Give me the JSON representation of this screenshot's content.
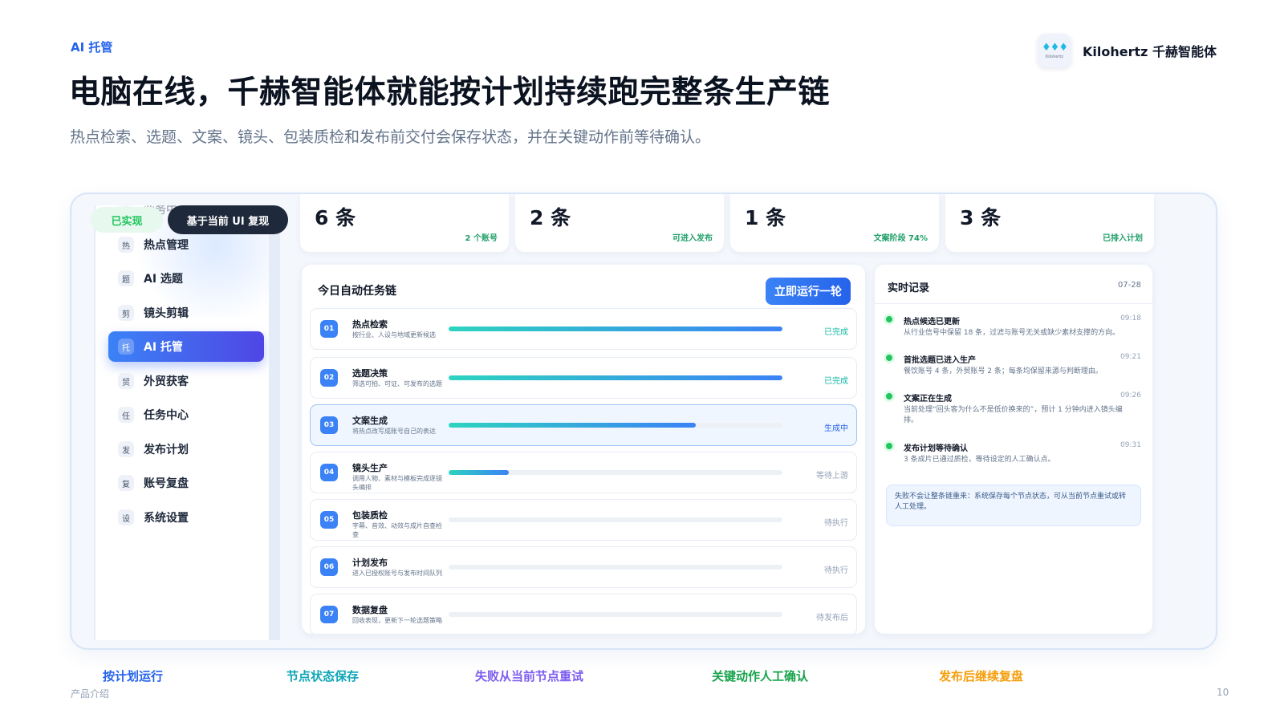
{
  "header": {
    "kicker": "AI 托管",
    "title": "电脑在线，千赫智能体就能按计划持续跑完整条生产链",
    "subtitle": "热点检索、选题、文案、镜头、包装质检和发布前交付会保存状态，并在关键动作前等待确认。",
    "brand_name": "Kilohertz 千赫智能体",
    "brand_logo_text": "Kilohertz"
  },
  "badges": {
    "done": "已实现",
    "replica": "基于当前 UI 复现"
  },
  "sidebar": {
    "items": [
      {
        "icon": "业",
        "label": "业务中心",
        "active": false
      },
      {
        "icon": "热",
        "label": "热点管理",
        "active": false
      },
      {
        "icon": "题",
        "label": "AI 选题",
        "active": false
      },
      {
        "icon": "剪",
        "label": "镜头剪辑",
        "active": false
      },
      {
        "icon": "托",
        "label": "AI 托管",
        "active": true
      },
      {
        "icon": "贸",
        "label": "外贸获客",
        "active": false
      },
      {
        "icon": "任",
        "label": "任务中心",
        "active": false
      },
      {
        "icon": "发",
        "label": "发布计划",
        "active": false
      },
      {
        "icon": "复",
        "label": "账号复盘",
        "active": false
      },
      {
        "icon": "设",
        "label": "系统设置",
        "active": false
      }
    ]
  },
  "stats": [
    {
      "value": "6 条",
      "sub": "2 个账号"
    },
    {
      "value": "2 条",
      "sub": "可进入发布"
    },
    {
      "value": "1 条",
      "sub": "文案阶段 74%"
    },
    {
      "value": "3 条",
      "sub": "已排入计划"
    }
  ],
  "chain": {
    "title": "今日自动任务链",
    "run_button": "立即运行一轮",
    "tasks": [
      {
        "num": "01",
        "name": "热点检索",
        "desc": "按行业、人设与地域更新候选",
        "progress": 1.0,
        "status": "已完成",
        "state": "done"
      },
      {
        "num": "02",
        "name": "选题决策",
        "desc": "筛选可拍、可证、可发布的选题",
        "progress": 1.0,
        "status": "已完成",
        "state": "done"
      },
      {
        "num": "03",
        "name": "文案生成",
        "desc": "将热点改写成账号自己的表达",
        "progress": 0.74,
        "status": "生成中",
        "state": "running"
      },
      {
        "num": "04",
        "name": "镜头生产",
        "desc": "调用人物、素材与模板完成逐镜头编排",
        "progress": 0.18,
        "status": "等待上游",
        "state": "waiting"
      },
      {
        "num": "05",
        "name": "包装质检",
        "desc": "字幕、音效、动效与成片自查检查",
        "progress": 0,
        "status": "待执行",
        "state": "pending"
      },
      {
        "num": "06",
        "name": "计划发布",
        "desc": "进入已授权账号与发布时间队列",
        "progress": 0,
        "status": "待执行",
        "state": "pending"
      },
      {
        "num": "07",
        "name": "数据复盘",
        "desc": "回收表现，更新下一轮选题策略",
        "progress": 0,
        "status": "待发布后",
        "state": "pending"
      }
    ]
  },
  "log": {
    "title": "实时记录",
    "date": "07-28",
    "entries": [
      {
        "title": "热点候选已更新",
        "time": "09:18",
        "desc": "从行业信号中保留 18 条，过滤与账号无关或缺少素材支撑的方向。"
      },
      {
        "title": "首批选题已进入生产",
        "time": "09:21",
        "desc": "餐饮账号 4 条，外贸账号 2 条；每条均保留来源与判断理由。"
      },
      {
        "title": "文案正在生成",
        "time": "09:26",
        "desc": "当前处理“回头客为什么不是低价换来的”，预计 1 分钟内进入镜头编排。"
      },
      {
        "title": "发布计划等待确认",
        "time": "09:31",
        "desc": "3 条成片已通过质检，等待设定的人工确认点。"
      }
    ],
    "note": "失败不会让整条链重来：系统保存每个节点状态，可从当前节点重试或转人工处理。"
  },
  "features": [
    {
      "label": "按计划运行",
      "color": "#2563eb"
    },
    {
      "label": "节点状态保存",
      "color": "#0ea5b7"
    },
    {
      "label": "失败从当前节点重试",
      "color": "#7c5cf0"
    },
    {
      "label": "关键动作人工确认",
      "color": "#16a34a"
    },
    {
      "label": "发布后继续复盘",
      "color": "#f59e0b"
    }
  ],
  "footer": {
    "left": "产品介绍",
    "page": "10"
  },
  "colors": {
    "accent": "#2563eb",
    "success": "#22c55e",
    "progress_start": "#2dd4bf",
    "progress_end": "#3b82f6"
  }
}
